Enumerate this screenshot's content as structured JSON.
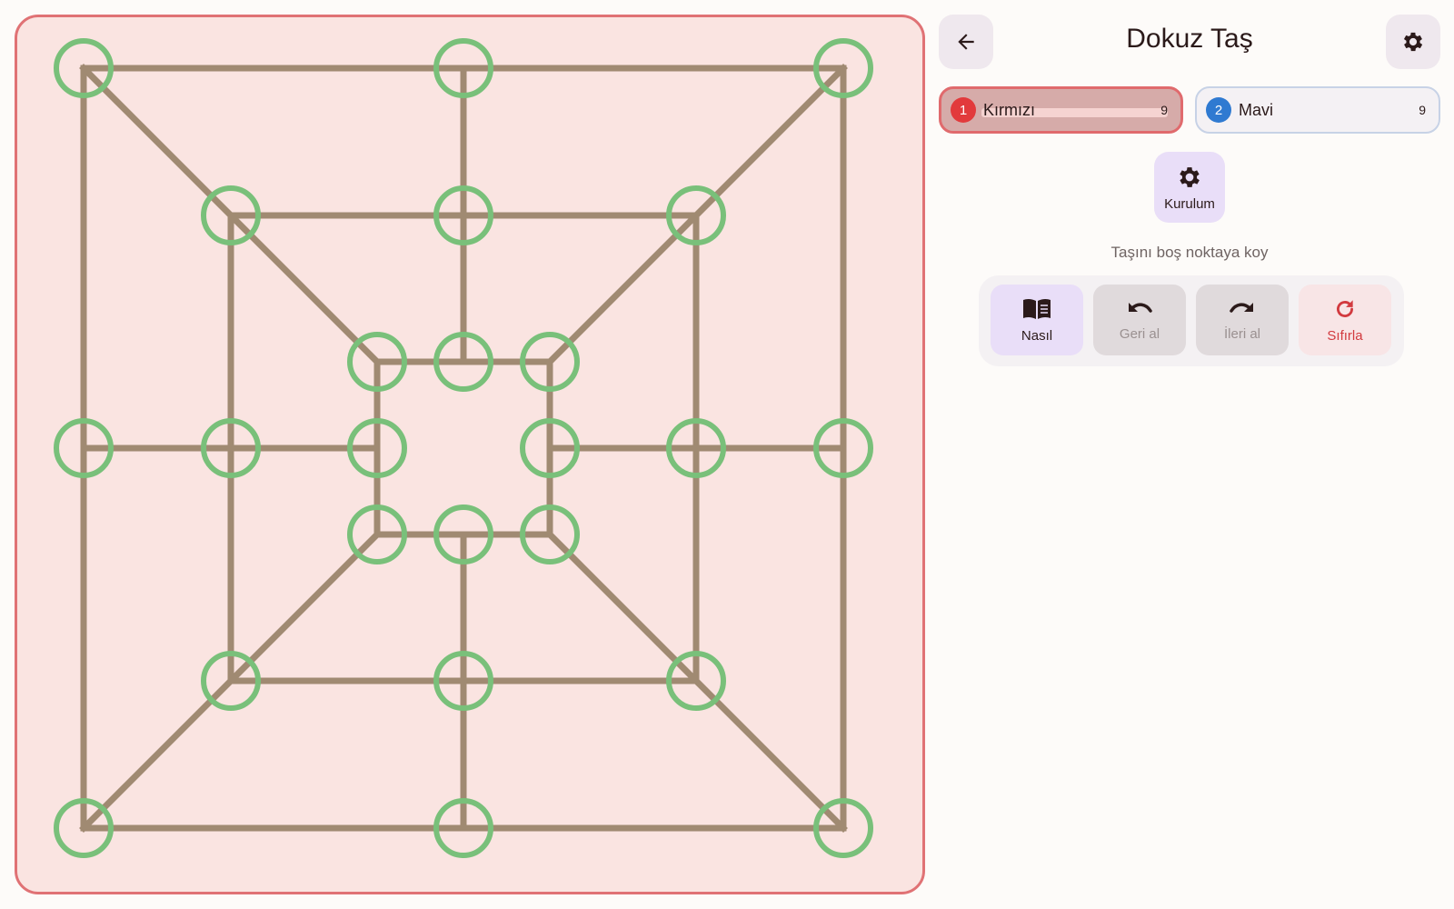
{
  "header": {
    "title": "Dokuz Taş",
    "back_icon": "arrow-left-icon",
    "settings_icon": "gear-icon"
  },
  "players": [
    {
      "number": "1",
      "name": "Kırmızı",
      "pieces": "9",
      "color": "#e23a3c",
      "active": true
    },
    {
      "number": "2",
      "name": "Mavi",
      "pieces": "9",
      "color": "#2f7ad1",
      "active": false
    }
  ],
  "setup": {
    "label": "Kurulum",
    "icon": "gear-icon"
  },
  "hint": "Taşını boş noktaya koy",
  "actions": {
    "how": {
      "label": "Nasıl",
      "icon": "book-icon",
      "enabled": true
    },
    "undo": {
      "label": "Geri al",
      "icon": "undo-icon",
      "enabled": false
    },
    "redo": {
      "label": "İleri al",
      "icon": "redo-icon",
      "enabled": false
    },
    "reset": {
      "label": "Sıfırla",
      "icon": "reset-icon",
      "enabled": true
    }
  },
  "board": {
    "type": "nine-mens-morris",
    "line_color": "#a08a72",
    "point_color": "#79c07a",
    "background": "#fae4e1",
    "border_color": "#e07275",
    "empty_points": 24
  }
}
